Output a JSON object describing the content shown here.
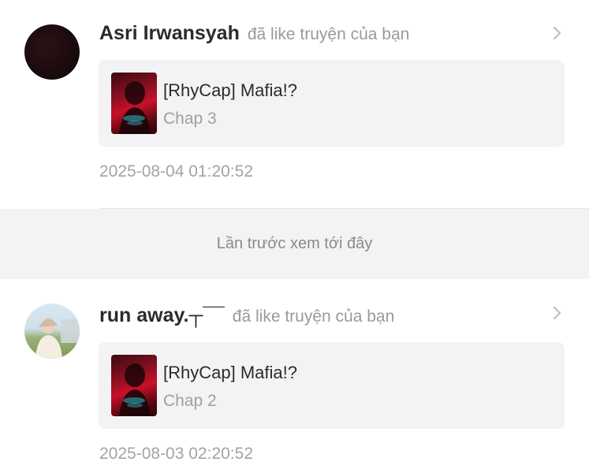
{
  "notifications": [
    {
      "username": "Asri Irwansyah",
      "action": "đã like truyện của bạn",
      "story_title": "[RhyCap] Mafia!?",
      "chapter": "Chap 3",
      "timestamp": "2025-08-04 01:20:52",
      "avatar": "dark-circle-avatar"
    },
    {
      "username": "run away.┬¯¯",
      "action": "đã like truyện của bạn",
      "story_title": "[RhyCap] Mafia!?",
      "chapter": "Chap 2",
      "timestamp": "2025-08-03 02:20:52",
      "avatar": "photo-avatar"
    }
  ],
  "divider": {
    "label": "Lần trước xem tới đây"
  },
  "icons": {
    "chevron": "chevron-right-icon"
  },
  "colors": {
    "background": "#ffffff",
    "card": "#f3f3f5",
    "divider_band": "#f3f3f4",
    "username": "#2b2b2b",
    "secondary_text": "#9a9a9a"
  }
}
